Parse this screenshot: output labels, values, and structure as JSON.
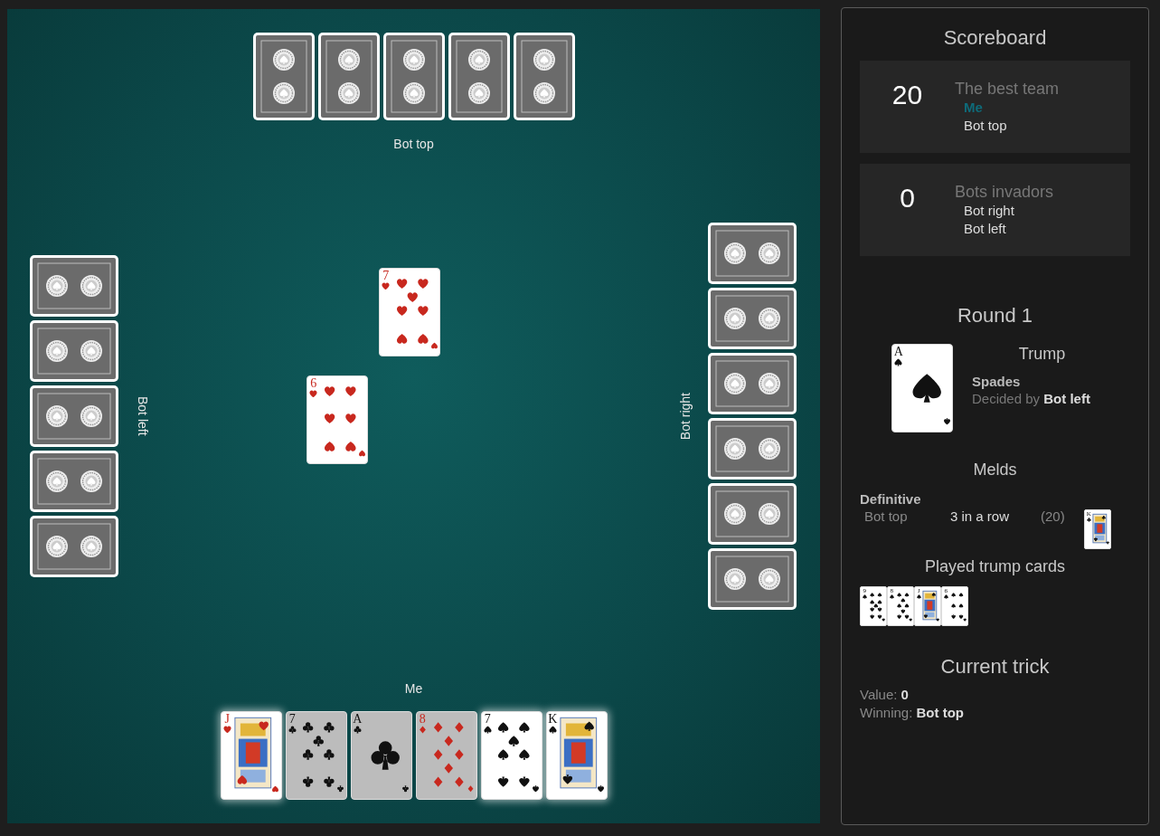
{
  "table": {
    "players": [
      {
        "kind": "top",
        "name": "Bot top",
        "cards": [
          {
            "kind": "back"
          },
          {
            "kind": "back"
          },
          {
            "kind": "back"
          },
          {
            "kind": "back"
          },
          {
            "kind": "back"
          }
        ],
        "played": {
          "rank": "7",
          "kind": "hearts"
        }
      },
      {
        "kind": "left",
        "name": "Bot left",
        "cards": [
          {
            "kind": "back"
          },
          {
            "kind": "back"
          },
          {
            "kind": "back"
          },
          {
            "kind": "back"
          },
          {
            "kind": "back"
          }
        ],
        "played": {
          "rank": "6",
          "kind": "hearts"
        }
      },
      {
        "kind": "right",
        "name": "Bot right",
        "cards": [
          {
            "kind": "back"
          },
          {
            "kind": "back"
          },
          {
            "kind": "back"
          },
          {
            "kind": "back"
          },
          {
            "kind": "back"
          },
          {
            "kind": "back"
          }
        ]
      },
      {
        "kind": "bottom",
        "name": "Me",
        "cards": [
          {
            "rank": "J",
            "kind": "hearts",
            "playable": true
          },
          {
            "rank": "7",
            "kind": "clubs",
            "playable": false
          },
          {
            "rank": "A",
            "kind": "clubs",
            "playable": false
          },
          {
            "rank": "8",
            "kind": "diamonds",
            "playable": false
          },
          {
            "rank": "7",
            "kind": "spades",
            "playable": true
          },
          {
            "rank": "K",
            "kind": "spades",
            "playable": true
          }
        ]
      }
    ]
  },
  "scoreboard": {
    "title": "Scoreboard",
    "teams": [
      {
        "score": "20",
        "name": "The best team",
        "members": [
          {
            "name": "Me",
            "highlighted": true
          },
          {
            "name": "Bot top",
            "highlighted": false
          }
        ]
      },
      {
        "score": "0",
        "name": "Bots invadors",
        "members": [
          {
            "name": "Bot right",
            "highlighted": false
          },
          {
            "name": "Bot left",
            "highlighted": false
          }
        ]
      }
    ]
  },
  "round": {
    "title": "Round 1",
    "trump": {
      "card": {
        "rank": "A",
        "kind": "spades"
      },
      "heading": "Trump",
      "suit_name": "Spades",
      "decided": "Decided by **Bot left**"
    }
  },
  "melds": {
    "title": "Melds",
    "groups": [
      {
        "label": "Definitive",
        "items": [
          {
            "player": "Bot top",
            "name": "3 in a row",
            "points": "(20)",
            "cards": [
              {
                "rank": "K",
                "kind": "clubs"
              }
            ]
          }
        ]
      }
    ]
  },
  "played_trumps": {
    "title": "Played trump cards",
    "cards": [
      {
        "rank": "9",
        "kind": "spades"
      },
      {
        "rank": "8",
        "kind": "spades"
      },
      {
        "rank": "J",
        "kind": "spades"
      },
      {
        "rank": "6",
        "kind": "spades"
      }
    ]
  },
  "current_trick": {
    "title": "Current trick",
    "value": "Value: **0**",
    "winning": "Winning: **Bot top**"
  }
}
